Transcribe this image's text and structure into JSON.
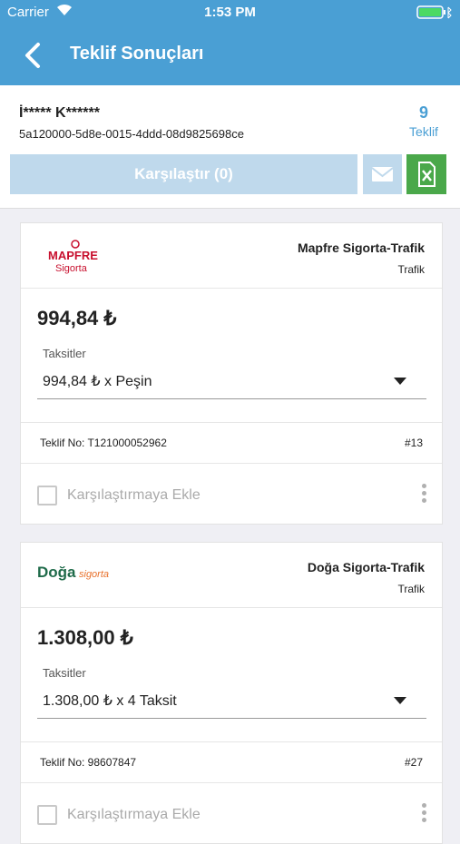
{
  "status_bar": {
    "carrier": "Carrier",
    "time": "1:53 PM"
  },
  "nav": {
    "title": "Teklif Sonuçları"
  },
  "header": {
    "user_name": "İ***** K******",
    "quote_id": "5a120000-5d8e-0015-4ddd-08d9825698ce",
    "offer_count": "9",
    "offer_count_label": "Teklif",
    "compare_label": "Karşılaştır (0)"
  },
  "colors": {
    "accent": "#4a9fd4",
    "excel": "#4aa84a",
    "disabled": "#bfd9ec"
  },
  "offers": [
    {
      "logo_text": "MAPFRE",
      "logo_sub": "Sigorta",
      "company": "Mapfre Sigorta-Trafik",
      "product": "Trafik",
      "price": "994,84 ₺",
      "installments_label": "Taksitler",
      "installment": "994,84 ₺ x Peşin",
      "offer_no": "Teklif No: T121000052962",
      "rank": "#13",
      "compare_label": "Karşılaştırmaya Ekle"
    },
    {
      "logo_text": "Doğa",
      "logo_sub": "sigorta",
      "company": "Doğa Sigorta-Trafik",
      "product": "Trafik",
      "price": "1.308,00 ₺",
      "installments_label": "Taksitler",
      "installment": "1.308,00 ₺ x 4 Taksit",
      "offer_no": "Teklif No: 98607847",
      "rank": "#27",
      "compare_label": "Karşılaştırmaya Ekle"
    }
  ]
}
